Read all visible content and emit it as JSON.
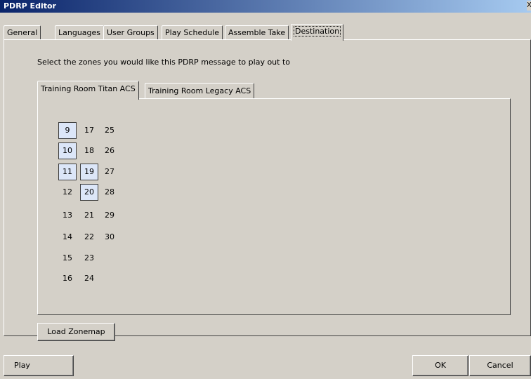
{
  "window": {
    "title": "PDRP Editor",
    "close_glyph": "X"
  },
  "tabs": [
    {
      "label": "General"
    },
    {
      "label": "Languages"
    },
    {
      "label": "User Groups"
    },
    {
      "label": "Play Schedule"
    },
    {
      "label": "Assemble Take"
    },
    {
      "label": "Destination",
      "active": true
    }
  ],
  "destination": {
    "instruction": "Select the zones you would like this PDRP message to play out to",
    "subtabs": [
      {
        "label": "Training Room Titan ACS",
        "active": true
      },
      {
        "label": "Training Room Legacy ACS"
      }
    ],
    "zones": [
      {
        "label": "9",
        "selected": true
      },
      {
        "label": "10",
        "selected": true
      },
      {
        "label": "11",
        "selected": true
      },
      {
        "label": "12",
        "selected": false
      },
      {
        "label": "13",
        "selected": false
      },
      {
        "label": "14",
        "selected": false
      },
      {
        "label": "15",
        "selected": false
      },
      {
        "label": "16",
        "selected": false
      },
      {
        "label": "17",
        "selected": false
      },
      {
        "label": "18",
        "selected": false
      },
      {
        "label": "19",
        "selected": true
      },
      {
        "label": "20",
        "selected": true
      },
      {
        "label": "21",
        "selected": false
      },
      {
        "label": "22",
        "selected": false
      },
      {
        "label": "23",
        "selected": false
      },
      {
        "label": "24",
        "selected": false
      },
      {
        "label": "25",
        "selected": false
      },
      {
        "label": "26",
        "selected": false
      },
      {
        "label": "27",
        "selected": false
      },
      {
        "label": "28",
        "selected": false
      },
      {
        "label": "29",
        "selected": false
      },
      {
        "label": "30",
        "selected": false
      }
    ],
    "load_zonemap_label": "Load Zonemap"
  },
  "footer": {
    "play_label": "Play",
    "ok_label": "OK",
    "cancel_label": "Cancel"
  },
  "colors": {
    "titlebar_start": "#0a246a",
    "titlebar_end": "#a6caf0",
    "dialog_face": "#d4d0c8",
    "selected_zone": "#dce6f8"
  }
}
